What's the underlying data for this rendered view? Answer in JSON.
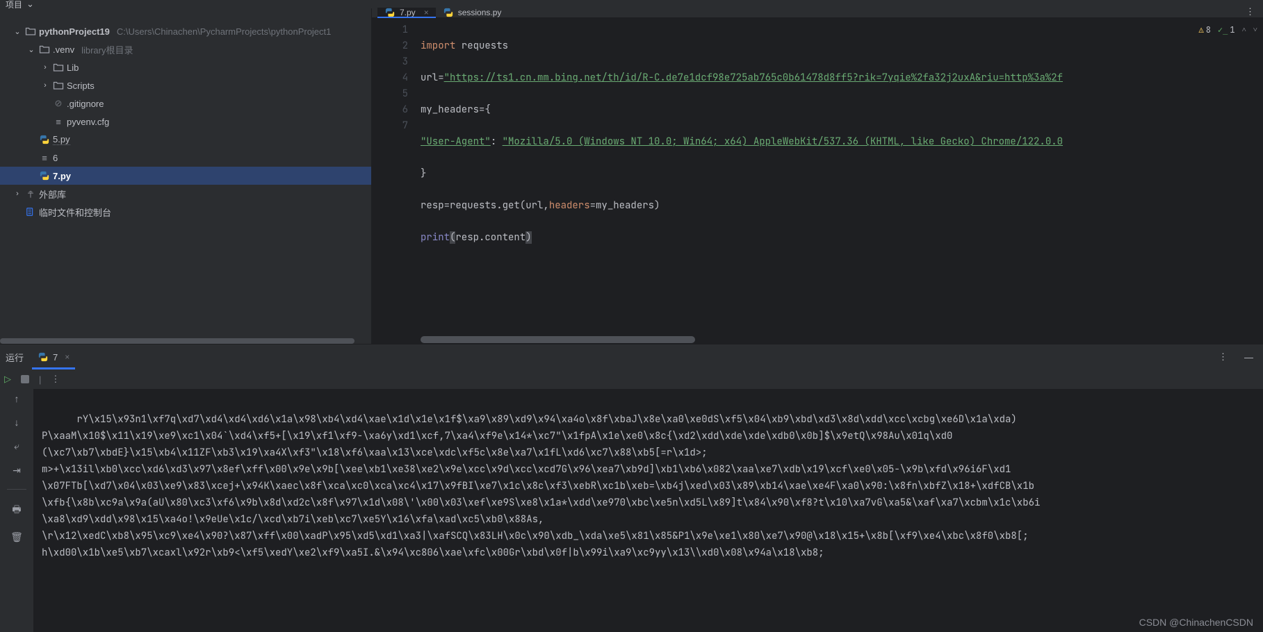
{
  "topbar": {
    "title": "项目"
  },
  "project": {
    "root": {
      "name": "pythonProject19",
      "path": "C:\\Users\\Chinachen\\PycharmProjects\\pythonProject1"
    },
    "venv": {
      "name": ".venv",
      "hint": "library根目录"
    },
    "lib": {
      "name": "Lib"
    },
    "scripts": {
      "name": "Scripts"
    },
    "gitignore": {
      "name": ".gitignore"
    },
    "pyvenv": {
      "name": "pyvenv.cfg"
    },
    "file5": {
      "name": "5.py"
    },
    "file6": {
      "name": "6"
    },
    "file7": {
      "name": "7.py"
    },
    "external": {
      "name": "外部库"
    },
    "scratch": {
      "name": "临时文件和控制台"
    }
  },
  "tabs": {
    "t1": {
      "label": "7.py"
    },
    "t2": {
      "label": "sessions.py"
    }
  },
  "editor": {
    "lines": [
      "1",
      "2",
      "3",
      "4",
      "5",
      "6",
      "7"
    ],
    "l1_kw": "import",
    "l1_mod": " requests",
    "l2_a": "url=",
    "l2_str": "\"https://ts1.cn.mm.bing.net/th/id/R-C.de7e1dcf98e725ab765c0b61478d8ff5?rik=7yqie%2fa32j2uxA&riu=http%3a%2f",
    "l3": "my_headers={",
    "l4_key": "\"User-Agent\"",
    "l4_colon": ": ",
    "l4_val": "\"Mozilla/5.0 (Windows NT 10.0; Win64; x64) AppleWebKit/537.36 (KHTML, like Gecko) Chrome/122.0.0",
    "l5": "}",
    "l6_a": "resp=requests.get(url,",
    "l6_param": "headers",
    "l6_b": "=my_headers)",
    "l7_fn": "print",
    "l7_open": "(",
    "l7_body": "resp.content",
    "l7_close": ")"
  },
  "badges": {
    "warn": "8",
    "ok": "1"
  },
  "run": {
    "title": "运行",
    "tab": "7",
    "output": "rY\\x15\\x93n1\\xf7q\\xd7\\xd4\\xd4\\xd6\\x1a\\x98\\xb4\\xd4\\xae\\x1d\\x1e\\x1f$\\xa9\\x89\\xd9\\x94\\xa4o\\x8f\\xbaJ\\x8e\\xa0\\xe0dS\\xf5\\x04\\xb9\\xbd\\xd3\\x8d\\xdd\\xcc\\xcbg\\xe6D\\x1a\\xda)\nP\\xaaM\\x10$\\x11\\x19\\xe9\\xc1\\x04`\\xd4\\xf5+[\\x19\\xf1\\xf9-\\xa6y\\xd1\\xcf,7\\xa4\\xf9e\\x14*\\xc7\"\\x1fpA\\x1e\\xe0\\x8c{\\xd2\\xdd\\xde\\xde\\xdb0\\x0b]$\\x9etQ\\x98Au\\x01q\\xd0\n(\\xc7\\xb7\\xbdE}\\x15\\xb4\\x11ZF\\xb3\\x19\\xa4X\\xf3\"\\x18\\xf6\\xaa\\x13\\xce\\xdc\\xf5c\\x8e\\xa7\\x1fL\\xd6\\xc7\\x88\\xb5[=r\\x1d>;\nm>+\\x13il\\xb0\\xcc\\xd6\\xd3\\x97\\x8ef\\xff\\x00\\x9e\\x9b[\\xee\\xb1\\xe38\\xe2\\x9e\\xcc\\x9d\\xcc\\xcd7G\\x96\\xea7\\xb9d]\\xb1\\xb6\\x082\\xaa\\xe7\\xdb\\x19\\xcf\\xe0\\x05-\\x9b\\xfd\\x96i6F\\xd1\n\\x07FTb[\\xd7\\x04\\x03\\xe9\\x83\\xcej+\\x94K\\xaec\\x8f\\xca\\xc0\\xca\\xc4\\x17\\x9fBI\\xe7\\x1c\\x8c\\xf3\\xebR\\xc1b\\xeb=\\xb4j\\xed\\x03\\x89\\xb14\\xae\\xe4F\\xa0\\x90:\\x8fn\\xbfZ\\x18+\\xdfCB\\x1b\n\\xfb{\\x8b\\xc9a\\x9a(aU\\x80\\xc3\\xf6\\x9b\\x8d\\xd2c\\x8f\\x97\\x1d\\x08\\'\\x00\\x03\\xef\\xe9S\\xe8\\x1a*\\xdd\\xe970\\xbc\\xe5n\\xd5L\\x89]t\\x84\\x90\\xf8?t\\x10\\xa7vG\\xa5&\\xaf\\xa7\\xcbm\\x1c\\xb6i\n\\xa8\\xd9\\xdd\\x98\\x15\\xa4o!\\x9eUe\\x1c/\\xcd\\xb7i\\xeb\\xc7\\xe5Y\\x16\\xfa\\xad\\xc5\\xb0\\x88As,\n\\r\\x12\\xedC\\xb8\\x95\\xc9\\xe4\\x90?\\x87\\xff\\x00\\xadP\\x95\\xd5\\xd1\\xa3|\\xafSCQ\\x83LH\\x0c\\x90\\xdb_\\xda\\xe5\\x81\\x85&P1\\x9e\\xe1\\x80\\xe7\\x90@\\x18\\x15+\\x8b[\\xf9\\xe4\\xbc\\x8f0\\xb8[;\nh\\xd00\\x1b\\xe5\\xb7\\xcaxl\\x92r\\xb9<\\xf5\\xedY\\xe2\\xf9\\xa5I.&\\x94\\xc806\\xae\\xfc\\x00Gr\\xbd\\x0f|b\\x99i\\xa9\\xc9yy\\x13\\\\xd0\\x08\\x94a\\x18\\xb8;"
  },
  "watermark": "CSDN @ChinachenCSDN"
}
